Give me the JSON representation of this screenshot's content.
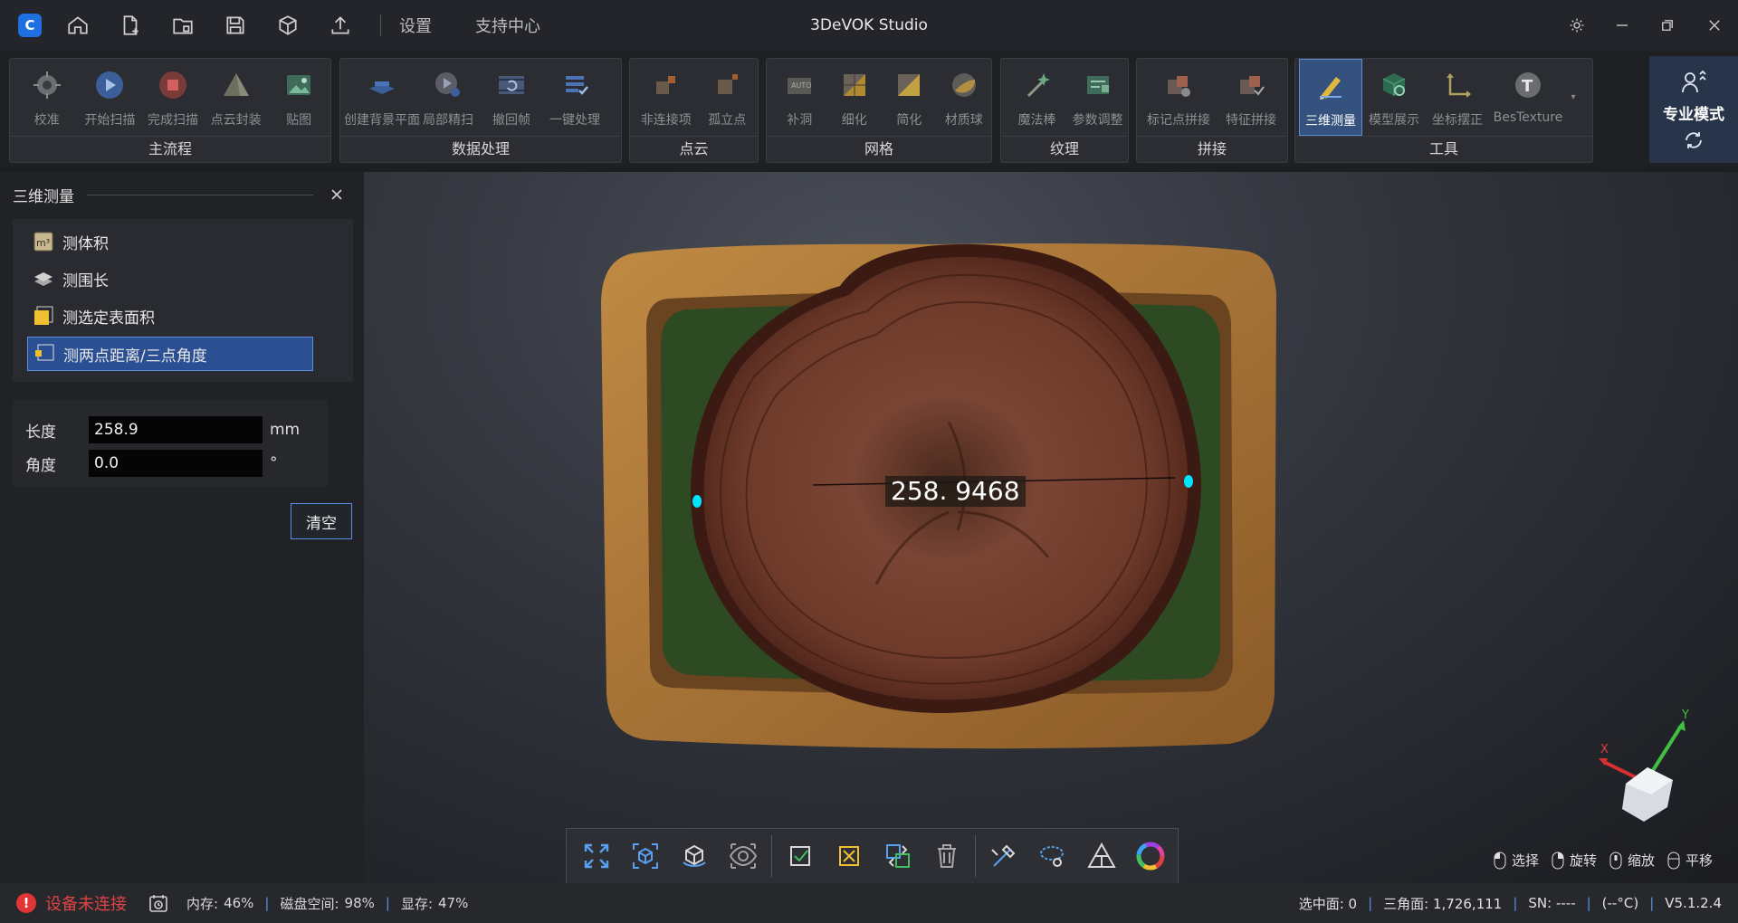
{
  "app": {
    "title": "3DeVOK Studio"
  },
  "titlebar": {
    "icons": [
      "home-icon",
      "new-project-icon",
      "open-project-icon",
      "save-icon",
      "export-model-icon",
      "upload-icon"
    ],
    "links": [
      "设置",
      "支持中心"
    ]
  },
  "ribbon": {
    "groups": [
      {
        "name": "主流程",
        "buttons": [
          "校准",
          "开始扫描",
          "完成扫描",
          "点云封装",
          "贴图"
        ]
      },
      {
        "name": "数据处理",
        "buttons": [
          "创建背景平面",
          "局部精扫",
          "撤回帧",
          "一键处理"
        ]
      },
      {
        "name": "点云",
        "buttons": [
          "非连接项",
          "孤立点"
        ]
      },
      {
        "name": "网格",
        "buttons": [
          "补洞",
          "细化",
          "简化",
          "材质球"
        ]
      },
      {
        "name": "纹理",
        "buttons": [
          "魔法棒",
          "参数调整"
        ]
      },
      {
        "name": "拼接",
        "buttons": [
          "标记点拼接",
          "特征拼接"
        ]
      },
      {
        "name": "工具",
        "buttons": [
          "三维测量",
          "模型展示",
          "坐标摆正",
          "BesTexture"
        ],
        "active": "三维测量"
      }
    ],
    "pro_mode": "专业模式"
  },
  "panel": {
    "title": "三维测量",
    "tools": [
      "测体积",
      "测围长",
      "测选定表面积",
      "测两点距离/三点角度"
    ],
    "selected_tool": "测两点距离/三点角度",
    "params": {
      "length_label": "长度",
      "length_value": "258.9",
      "length_unit": "mm",
      "angle_label": "角度",
      "angle_value": "0.0",
      "angle_unit": "°"
    },
    "clear_label": "清空"
  },
  "viewport": {
    "measurement_label": "258. 9468",
    "axis": {
      "x": "X",
      "y": "Y"
    },
    "hints": [
      "选择",
      "旋转",
      "缩放",
      "平移"
    ]
  },
  "status": {
    "device": "设备未连接",
    "memory_label": "内存:",
    "memory": "46%",
    "disk_label": "磁盘空间:",
    "disk": "98%",
    "gpu_label": "显存:",
    "gpu": "47%",
    "selected_faces": "选中面: 0",
    "triangles": "三角面: 1,726,111",
    "sn": "SN: ----",
    "temp": "(--°C)",
    "version": "V5.1.2.4"
  },
  "colors": {
    "accent": "#2a4f93",
    "error": "#e03535",
    "cyan_point": "#00e5ff"
  }
}
